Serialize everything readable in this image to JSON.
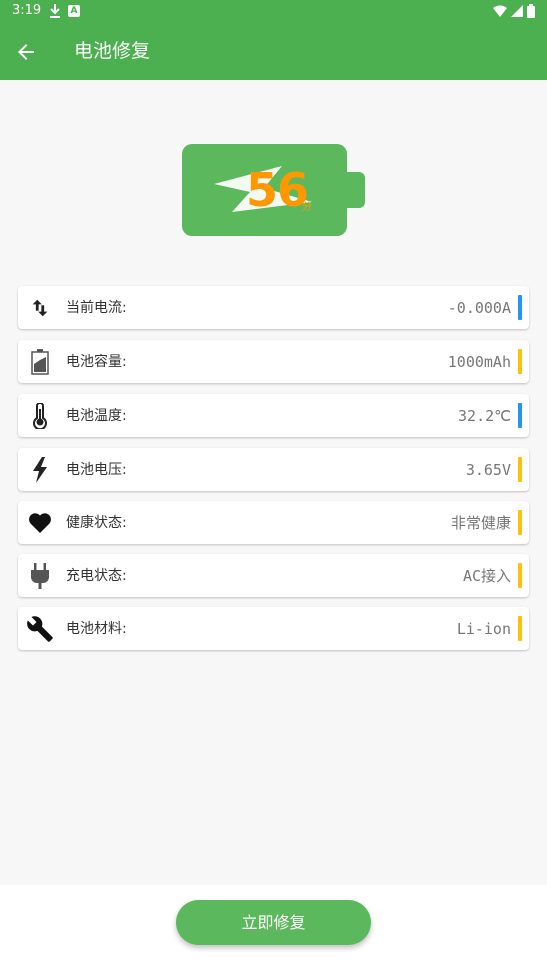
{
  "status_bar": {
    "time": "3:19",
    "a_icon": "A"
  },
  "app_bar": {
    "title": "电池修复"
  },
  "battery": {
    "score": "56",
    "unit": "分",
    "color": "#5cb85c",
    "score_color": "#ff9800"
  },
  "items": [
    {
      "label": "当前电流:",
      "value": "-0.000A",
      "icon": "current-arrows-icon",
      "bar_color": "#2196f3"
    },
    {
      "label": "电池容量:",
      "value": "1000mAh",
      "icon": "battery-capacity-icon",
      "bar_color": "#ffc107"
    },
    {
      "label": "电池温度:",
      "value": "32.2℃",
      "icon": "thermometer-icon",
      "bar_color": "#2196f3"
    },
    {
      "label": "电池电压:",
      "value": "3.65V",
      "icon": "lightning-icon",
      "bar_color": "#ffc107"
    },
    {
      "label": "健康状态:",
      "value": "非常健康",
      "icon": "heart-icon",
      "bar_color": "#ffc107"
    },
    {
      "label": "充电状态:",
      "value": "AC接入",
      "icon": "plug-icon",
      "bar_color": "#ffc107"
    },
    {
      "label": "电池材料:",
      "value": "Li-ion",
      "icon": "wrench-icon",
      "bar_color": "#ffc107"
    }
  ],
  "repair_button": {
    "label": "立即修复"
  },
  "colors": {
    "primary": "#4caf50",
    "accent_blue": "#2196f3",
    "accent_yellow": "#ffc107"
  }
}
